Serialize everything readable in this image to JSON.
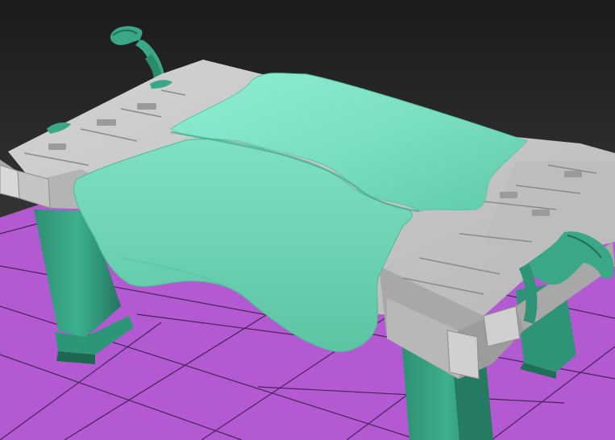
{
  "viewport": {
    "background_top": "#1a1a1a",
    "background_bottom": "#444444",
    "grid_color": "#b25ad2",
    "grid_line_color": "#3a1f45",
    "table_stone_color": "#c7c7c7",
    "table_stone_dark": "#8f8f8f",
    "cloth_color": "#7fe3c6",
    "cloth_shadow": "#4dbf9e",
    "legs_color": "#3aa886",
    "legs_dark": "#1f6e57"
  }
}
